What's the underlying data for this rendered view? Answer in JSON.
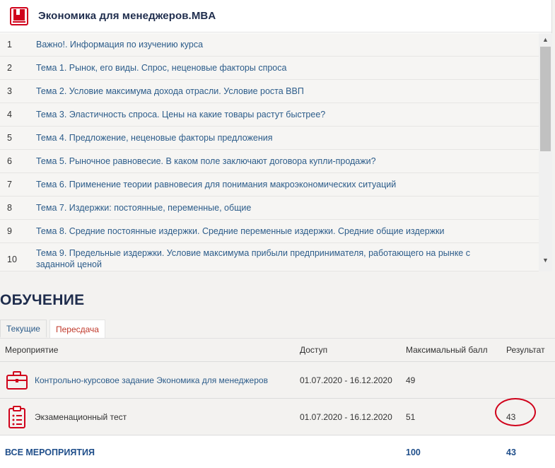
{
  "course": {
    "title": "Экономика для менеджеров.MBA",
    "topics": [
      {
        "num": "1",
        "label": "Важно!. Информация по изучению курса"
      },
      {
        "num": "2",
        "label": "Тема 1. Рынок, его виды. Спрос, неценовые факторы спроса"
      },
      {
        "num": "3",
        "label": "Тема 2. Условие максимума дохода отрасли. Условие роста ВВП"
      },
      {
        "num": "4",
        "label": "Тема 3. Эластичность спроса. Цены на какие товары растут быстрее?"
      },
      {
        "num": "5",
        "label": "Тема 4. Предложение, неценовые факторы предложения"
      },
      {
        "num": "6",
        "label": "Тема 5. Рыночное равновесие. В каком поле заключают договора купли-продажи?"
      },
      {
        "num": "7",
        "label": "Тема 6. Применение теории равновесия для понимания макроэкономических ситуаций"
      },
      {
        "num": "8",
        "label": "Тема 7. Издержки: постоянные, переменные, общие"
      },
      {
        "num": "9",
        "label": "Тема 8. Средние постоянные издержки. Средние переменные издержки. Средние общие издержки"
      },
      {
        "num": "10",
        "label": "Тема 9. Предельные издержки. Условие максимума прибыли предпринимателя, работающего на рынке с заданной ценой"
      }
    ]
  },
  "training": {
    "title": "ОБУЧЕНИЕ",
    "tabs": [
      "Текущие",
      "Пересдача"
    ],
    "columns": [
      "Мероприятие",
      "Доступ",
      "Максимальный балл",
      "Результат"
    ],
    "events": [
      {
        "name": "Контрольно-курсовое задание Экономика для менеджеров",
        "access": "01.07.2020 - 16.12.2020",
        "max": "49",
        "result": "",
        "icon": "briefcase-icon"
      },
      {
        "name": "Экзаменационный тест",
        "access": "01.07.2020 - 16.12.2020",
        "max": "51",
        "result": "43",
        "icon": "clipboard-icon"
      }
    ],
    "total": {
      "label": "ВСЕ МЕРОПРИЯТИЯ",
      "max": "100",
      "result": "43"
    }
  },
  "colors": {
    "accent": "#d0021b",
    "navy": "#1f2d4d",
    "link": "#2c5c8a"
  }
}
